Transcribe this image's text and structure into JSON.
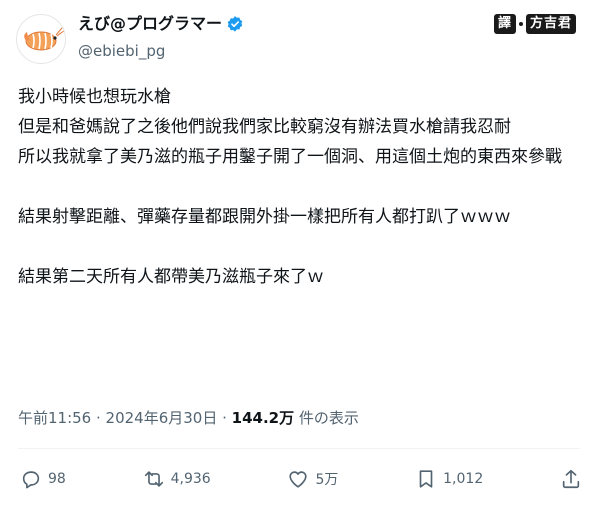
{
  "user": {
    "display_name": "えび@プログラマー",
    "handle": "@ebiebi_pg",
    "verified": true,
    "avatar_icon": "shrimp-avatar-icon"
  },
  "watermark": {
    "label": "譯",
    "name": "方吉君"
  },
  "tweet": {
    "text": "我小時候也想玩水槍\n但是和爸媽說了之後他們說我們家比較窮沒有辦法買水槍請我忍耐\n所以我就拿了美乃滋的瓶子用鑿子開了一個洞、用這個土炮的東西來參戰\n\n結果射擊距離、彈藥存量都跟開外掛一樣把所有人都打趴了ｗｗｗ\n\n結果第二天所有人都帶美乃滋瓶子來了ｗ"
  },
  "meta": {
    "time": "午前11:56",
    "separator1": " · ",
    "date": "2024年6月30日",
    "separator2": " · ",
    "views": "144.2万",
    "views_label": " 件の表示"
  },
  "actions": {
    "reply": {
      "icon": "reply-icon",
      "count": "98"
    },
    "retweet": {
      "icon": "retweet-icon",
      "count": "4,936"
    },
    "like": {
      "icon": "heart-icon",
      "count": "5万"
    },
    "bookmark": {
      "icon": "bookmark-icon",
      "count": "1,012"
    },
    "share": {
      "icon": "share-icon"
    }
  },
  "colors": {
    "text": "#0f1419",
    "secondary": "#536471",
    "verified": "#1d9bf0"
  }
}
